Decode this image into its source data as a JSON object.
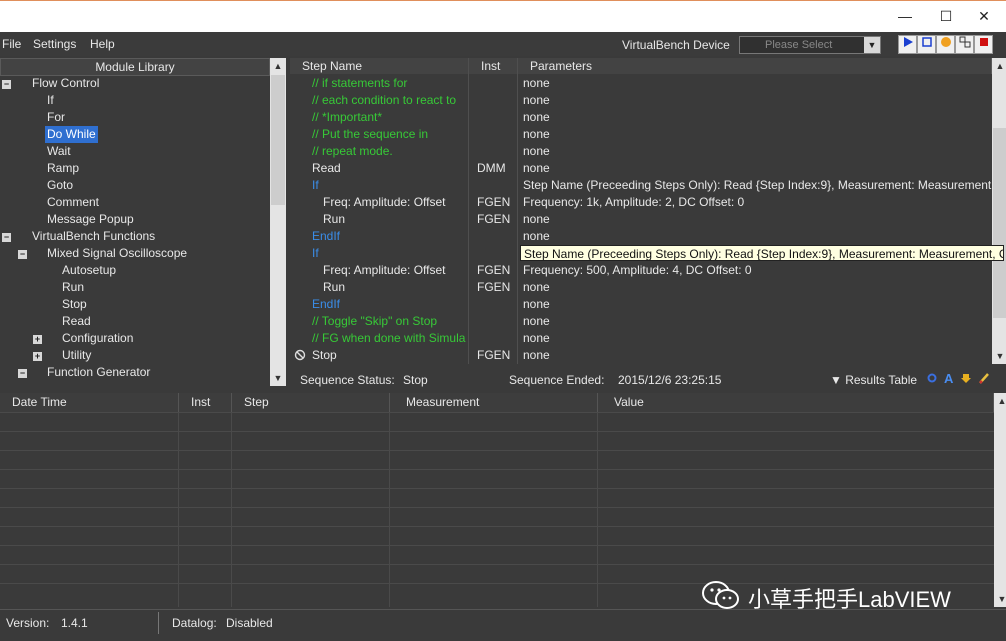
{
  "window": {
    "controls": {
      "minimize": "—",
      "maximize": "☐",
      "close": "✕"
    }
  },
  "menu": {
    "file": "File",
    "settings": "Settings",
    "help": "Help"
  },
  "device": {
    "label": "VirtualBench Device",
    "placeholder": "Please Select"
  },
  "toolbar": {
    "run_icon": "play-icon",
    "loop_icon": "loop-icon",
    "pause_icon": "pause-icon",
    "step_icon": "step-icon",
    "stop_icon": "stop-icon"
  },
  "library": {
    "title": "Module Library",
    "items": [
      {
        "label": "Flow Control",
        "toggle": "−"
      },
      {
        "label": "If"
      },
      {
        "label": "For"
      },
      {
        "label": "Do While"
      },
      {
        "label": "Wait"
      },
      {
        "label": "Ramp"
      },
      {
        "label": "Goto"
      },
      {
        "label": "Comment"
      },
      {
        "label": "Message Popup"
      },
      {
        "label": "VirtualBench Functions",
        "toggle": "−"
      },
      {
        "label": "Mixed Signal Oscilloscope",
        "toggle": "−"
      },
      {
        "label": "Autosetup"
      },
      {
        "label": "Run"
      },
      {
        "label": "Stop"
      },
      {
        "label": "Read"
      },
      {
        "label": "Configuration",
        "toggle": "+"
      },
      {
        "label": "Utility",
        "toggle": "+"
      },
      {
        "label": "Function Generator",
        "toggle": "−"
      }
    ]
  },
  "sequence": {
    "columns": {
      "step": "Step Name",
      "inst": "Inst",
      "params": "Parameters"
    },
    "rows": [
      {
        "step": "// if statements for",
        "inst": "",
        "params": "none"
      },
      {
        "step": "// each condition to react to",
        "inst": "",
        "params": "none"
      },
      {
        "step": "// *Important*",
        "inst": "",
        "params": "none"
      },
      {
        "step": "// Put the sequence in",
        "inst": "",
        "params": "none"
      },
      {
        "step": "// repeat mode.",
        "inst": "",
        "params": "none"
      },
      {
        "step": "Read",
        "inst": "DMM",
        "params": "none"
      },
      {
        "step": "If",
        "inst": "",
        "params": "Step Name (Preceeding Steps Only): Read {Step Index:9}, Measurement: Measurement"
      },
      {
        "step": "Freq: Amplitude: Offset",
        "inst": "FGEN",
        "params": "Frequency: 1k, Amplitude: 2, DC Offset: 0"
      },
      {
        "step": "Run",
        "inst": "FGEN",
        "params": "none"
      },
      {
        "step": "EndIf",
        "inst": "",
        "params": "none"
      },
      {
        "step": "If",
        "inst": "",
        "params": ""
      },
      {
        "step": "Freq: Amplitude: Offset",
        "inst": "FGEN",
        "params": "Frequency: 500, Amplitude: 4, DC Offset: 0"
      },
      {
        "step": "Run",
        "inst": "FGEN",
        "params": "none"
      },
      {
        "step": "EndIf",
        "inst": "",
        "params": "none"
      },
      {
        "step": "// Toggle \"Skip\" on Stop",
        "inst": "",
        "params": "none"
      },
      {
        "step": "// FG when done with Simula",
        "inst": "",
        "params": "none"
      },
      {
        "step": "Stop",
        "inst": "FGEN",
        "params": "none"
      }
    ],
    "tooltip": "Step Name (Preceeding Steps Only): Read {Step Index:9}, Measurement: Measurement, C"
  },
  "status": {
    "seq_status_label": "Sequence Status:",
    "seq_status_value": "Stop",
    "seq_ended_label": "Sequence Ended:",
    "seq_ended_value": "2015/12/6 23:25:15",
    "results_table": "▼ Results Table"
  },
  "results": {
    "columns": [
      "Date Time",
      "Inst",
      "Step",
      "Measurement",
      "Value"
    ]
  },
  "footer": {
    "version_label": "Version:",
    "version_value": "1.4.1",
    "datalog_label": "Datalog:",
    "datalog_value": "Disabled"
  },
  "watermark": {
    "text": "小草手把手LabVIEW"
  },
  "colors": {
    "comment": "#37c937",
    "flow": "#3a8de8",
    "selection": "#2f6fd0",
    "panel": "#3a3a3a"
  }
}
